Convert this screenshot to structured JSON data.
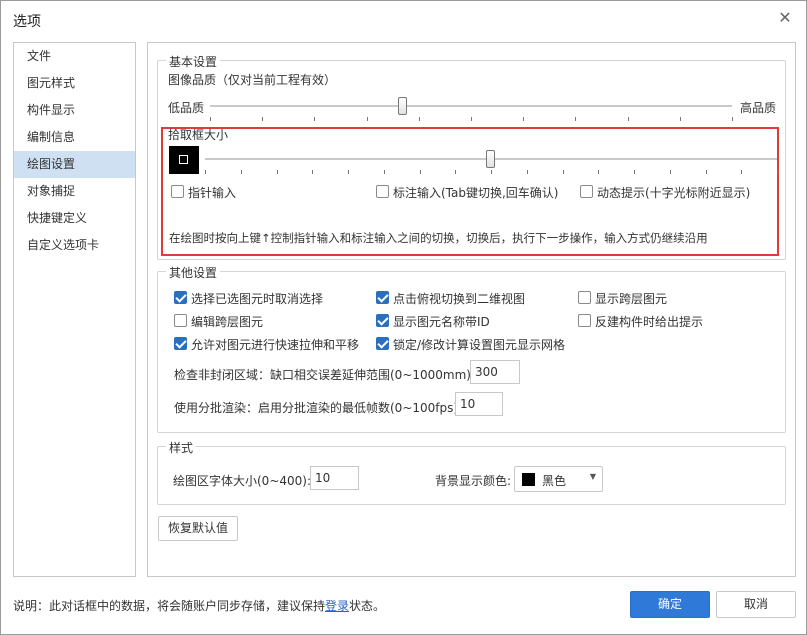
{
  "window": {
    "title": "选项",
    "close_icon": "close-icon"
  },
  "nav": {
    "items": [
      {
        "label": "文件"
      },
      {
        "label": "图元样式"
      },
      {
        "label": "构件显示"
      },
      {
        "label": "编制信息"
      },
      {
        "label": "绘图设置",
        "active": true
      },
      {
        "label": "对象捕捉"
      },
      {
        "label": "快捷键定义"
      },
      {
        "label": "自定义选项卡"
      }
    ]
  },
  "basic": {
    "legend": "基本设置",
    "image_quality_label": "图像品质（仅对当前工程有效）",
    "low_label": "低品质",
    "high_label": "高品质",
    "image_quality_value": 0.37,
    "pick_box_label": "拾取框大小",
    "pick_box_value": 0.5,
    "pointer_input": {
      "label": "指针输入",
      "checked": false
    },
    "dim_input": {
      "label": "标注输入(Tab键切换,回车确认)",
      "checked": false
    },
    "dynamic_hint": {
      "label": "动态提示(十字光标附近显示)",
      "checked": false
    },
    "hint_text": "在绘图时按向上键↑控制指针输入和标注输入之间的切换，切换后，执行下一步操作，输入方式仍继续沿用"
  },
  "other": {
    "legend": "其他设置",
    "checks": [
      {
        "label": "选择已选图元时取消选择",
        "checked": true
      },
      {
        "label": "点击俯视切换到二维视图",
        "checked": true
      },
      {
        "label": "显示跨层图元",
        "checked": false
      },
      {
        "label": "编辑跨层图元",
        "checked": false
      },
      {
        "label": "显示图元名称带ID",
        "checked": true
      },
      {
        "label": "反建构件时给出提示",
        "checked": false
      },
      {
        "label": "允许对图元进行快速拉伸和平移",
        "checked": true
      },
      {
        "label": "锁定/修改计算设置图元显示网格",
        "checked": true
      }
    ],
    "gap_label": "检查非封闭区域：缺口相交误差延伸范围(0~1000mm):",
    "gap_value": "300",
    "batch_label": "使用分批渲染：启用分批渲染的最低帧数(0~100fps):",
    "batch_value": "10"
  },
  "style": {
    "legend": "样式",
    "font_size_label": "绘图区字体大小(0~400):",
    "font_size_value": "10",
    "bg_color_label": "背景显示颜色:",
    "bg_color_value": "黑色",
    "bg_color_hex": "#000000"
  },
  "restore_label": "恢复默认值",
  "footer": {
    "note_prefix": "说明：此对话框中的数据，将会随账户同步存储，建议保持",
    "note_link": "登录",
    "note_suffix": "状态。",
    "ok_label": "确定",
    "cancel_label": "取消"
  },
  "colors": {
    "accent": "#2f7ad8",
    "highlight": "#e03a3a",
    "nav_active": "#cfe0f3"
  }
}
